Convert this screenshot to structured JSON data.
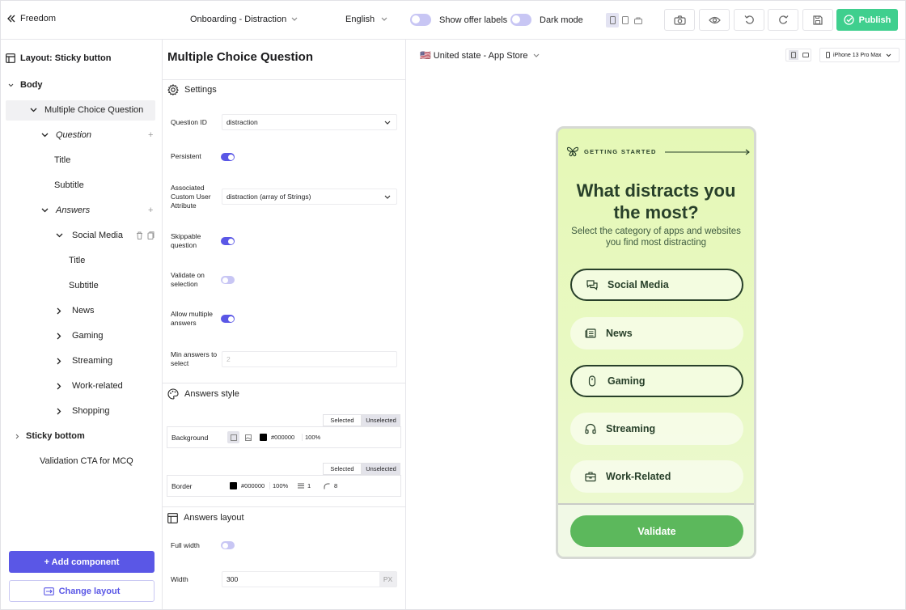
{
  "topbar": {
    "back_label": "Freedom",
    "flow_name": "Onboarding - Distraction",
    "language": "English",
    "show_offer_labels_label": "Show offer labels",
    "dark_mode_label": "Dark mode",
    "publish_label": "Publish"
  },
  "sidebar": {
    "layout_title": "Layout: Sticky button",
    "tree": [
      {
        "label": "Body",
        "bold": true
      },
      {
        "label": "Multiple Choice Question"
      },
      {
        "label": "Question",
        "italic": true
      },
      {
        "label": "Title"
      },
      {
        "label": "Subtitle"
      },
      {
        "label": "Answers",
        "italic": true
      },
      {
        "label": "Social Media"
      },
      {
        "label": "Title"
      },
      {
        "label": "Subtitle"
      },
      {
        "label": "News"
      },
      {
        "label": "Gaming"
      },
      {
        "label": "Streaming"
      },
      {
        "label": "Work-related"
      },
      {
        "label": "Shopping"
      },
      {
        "label": "Sticky bottom",
        "bold": true
      },
      {
        "label": "Validation CTA for MCQ"
      }
    ],
    "add_component_label": "+ Add component",
    "change_layout_label": "Change layout"
  },
  "properties": {
    "title": "Multiple Choice Question",
    "settings_label": "Settings",
    "question_id_label": "Question ID",
    "question_id_value": "distraction",
    "persistent_label": "Persistent",
    "persistent_value": true,
    "attribute_label_1": "Associated",
    "attribute_label_2": "Custom User",
    "attribute_label_3": "Attribute",
    "attribute_value": "distraction (array of Strings)",
    "skippable_label_1": "Skippable",
    "skippable_label_2": "question",
    "skippable_value": true,
    "validate_label_1": "Validate on",
    "validate_label_2": "selection",
    "validate_value": false,
    "allow_multiple_label_1": "Allow multiple",
    "allow_multiple_label_2": "answers",
    "allow_multiple_value": true,
    "min_answers_label_1": "Min answers to",
    "min_answers_label_2": "select",
    "min_answers_placeholder": "2",
    "answers_style_label": "Answers style",
    "tab_selected": "Selected",
    "tab_unselected": "Unselected",
    "background_label": "Background",
    "background_color": "#000000",
    "background_opacity": "100%",
    "border_label": "Border",
    "border_color": "#000000",
    "border_opacity": "100%",
    "border_width": "1",
    "border_radius": "8",
    "answers_layout_label": "Answers layout",
    "full_width_label": "Full width",
    "full_width_value": false,
    "width_label": "Width",
    "width_value": "300",
    "width_unit": "PX"
  },
  "preview": {
    "store_label": "🇺🇸 United state - App Store",
    "device_label": "iPhone 13 Pro Max",
    "getting_started": "GETTING STARTED",
    "heading_line1": "What distracts you",
    "heading_line2": "the most?",
    "subtitle_line1": "Select the category of apps and websites",
    "subtitle_line2": "you find most distracting",
    "options": [
      {
        "label": "Social Media",
        "selected": true,
        "icon": "chat-bubbles-icon"
      },
      {
        "label": "News",
        "selected": false,
        "icon": "newspaper-icon"
      },
      {
        "label": "Gaming",
        "selected": true,
        "icon": "mouse-icon"
      },
      {
        "label": "Streaming",
        "selected": false,
        "icon": "headphones-icon"
      },
      {
        "label": "Work-Related",
        "selected": false,
        "icon": "briefcase-icon"
      }
    ],
    "validate_label": "Validate"
  },
  "colors": {
    "accent": "#5a57e6",
    "publish": "#3fcf8e",
    "phone_button": "#5cb85c",
    "phone_text": "#28402a"
  }
}
